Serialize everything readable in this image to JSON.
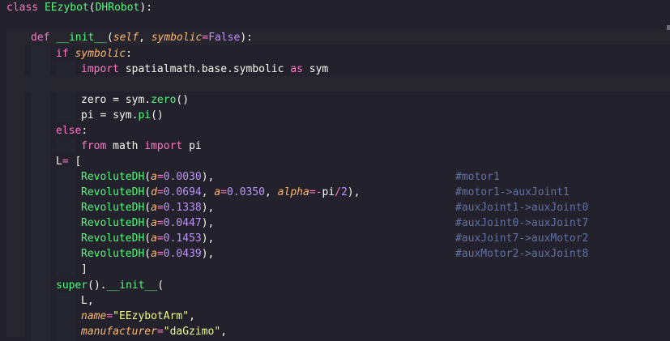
{
  "colors": {
    "background": "#22212c",
    "keyword": "#ff79c6",
    "class_name": "#8be9fd",
    "function": "#50fa7b",
    "parameter": "#ffb86c",
    "number": "#bd93f9",
    "string": "#f1fa8c",
    "comment": "#6272a4",
    "text": "#f8f8f2"
  },
  "code": {
    "l1": {
      "kw": "class",
      "sp": " ",
      "name": "EEzybot",
      "open": "(",
      "base": "DHRobot",
      "close": "):"
    },
    "l3": {
      "kw": "def",
      "sp": " ",
      "name": "__init__",
      "open": "(",
      "self": "self",
      "comma": ", ",
      "param": "symbolic",
      "eq": "=",
      "val": "False",
      "close": "):"
    },
    "l4": {
      "kw": "if",
      "sp": " ",
      "cond": "symbolic",
      "colon": ":"
    },
    "l5": {
      "kw": "import",
      "mod": " spatialmath.base.symbolic ",
      "as": "as",
      "alias": " sym"
    },
    "l7": {
      "var": "zero",
      "eq": " = ",
      "obj": "sym.",
      "fn": "zero",
      "call": "()"
    },
    "l8": {
      "var": "pi",
      "eq": " = ",
      "obj": "sym.",
      "fn": "pi",
      "call": "()"
    },
    "l9": {
      "kw": "else",
      "colon": ":"
    },
    "l10": {
      "kw": "from",
      "mod": " math ",
      "imp": "import",
      "name": " pi"
    },
    "l11": {
      "var": "L",
      "eq": "=",
      "rest": " ["
    },
    "l12": {
      "fn": "RevoluteDH",
      "open": "(",
      "p1": "a",
      "eq1": "=",
      "v1": "0.0030",
      "close": "),",
      "comment": "#motor1"
    },
    "l13": {
      "fn": "RevoluteDH",
      "open": "(",
      "p1": "d",
      "eq1": "=",
      "v1": "0.0694",
      "sep1": ", ",
      "p2": "a",
      "eq2": "=",
      "v2": "0.0350",
      "sep2": ", ",
      "p3": "alpha",
      "eq3": "=",
      "v3a": "-",
      "v3b": "pi",
      "v3c": "/",
      "v3d": "2",
      "close": "),",
      "comment": "#motor1->auxJoint1"
    },
    "l14": {
      "fn": "RevoluteDH",
      "open": "(",
      "p1": "a",
      "eq1": "=",
      "v1": "0.1338",
      "close": "),",
      "comment": "#auxJoint1->auxJoint0"
    },
    "l15": {
      "fn": "RevoluteDH",
      "open": "(",
      "p1": "a",
      "eq1": "=",
      "v1": "0.0447",
      "close": "),",
      "comment": "#auxJoint0->auxJoint7"
    },
    "l16": {
      "fn": "RevoluteDH",
      "open": "(",
      "p1": "a",
      "eq1": "=",
      "v1": "0.1453",
      "close": "),",
      "comment": "#auxJoint7->auxMotor2"
    },
    "l17": {
      "fn": "RevoluteDH",
      "open": "(",
      "p1": "a",
      "eq1": "=",
      "v1": "0.0439",
      "close": "),",
      "comment": "#auxMotor2->auxJoint8"
    },
    "l18": {
      "text": "]"
    },
    "l19": {
      "fn": "super",
      "call": "().",
      "fn2": "__init__",
      "open": "("
    },
    "l20": {
      "var": "L",
      "comma": ","
    },
    "l21": {
      "param": "name",
      "eq": "=",
      "str": "\"EEzybotArm\"",
      "comma": ","
    },
    "l22": {
      "param": "manufacturer",
      "eq": "=",
      "str": "\"daGzimo\"",
      "comma": ","
    }
  }
}
